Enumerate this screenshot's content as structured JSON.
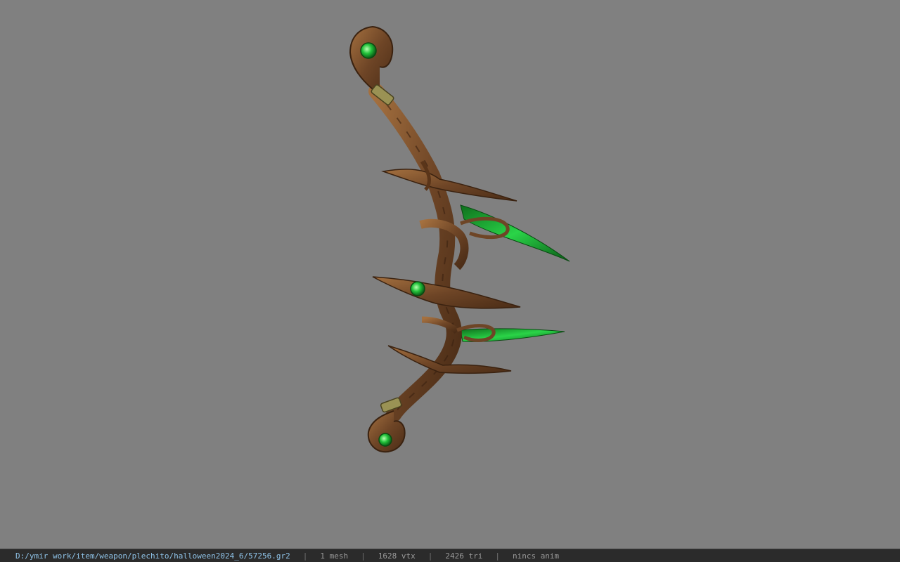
{
  "viewer": {
    "background_color": "#808080",
    "model_icon": "bow-model-icon"
  },
  "status": {
    "file_path": "D:/ymir work/item/weapon/plechito/halloween2024_6/57256.gr2",
    "mesh_count": "1 mesh",
    "vertex_count": "1628 vtx",
    "triangle_count": "2426 tri",
    "animation": "nincs anim",
    "separator": "|",
    "path_color": "#8fc3e8",
    "text_color": "#9a9a9a"
  },
  "colors": {
    "wood": "#6e4526",
    "wood_light": "#9a6a3e",
    "gem_green": "#22c23a",
    "blade_green": "#1aa52e",
    "metal_band": "#9a9254"
  }
}
